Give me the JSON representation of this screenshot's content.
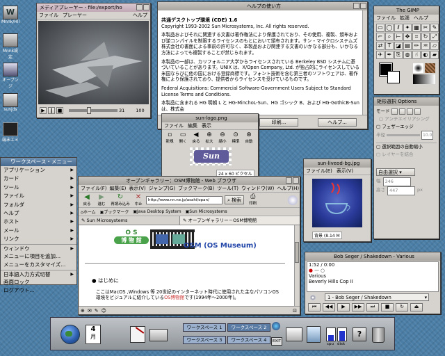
{
  "desktop_icons": [
    {
      "label": "Mnnk/Hll"
    },
    {
      "label": "Mnnk設定"
    },
    {
      "label": "オープンジ"
    },
    {
      "label": "sunjds"
    },
    {
      "label": "端末エミ"
    }
  ],
  "media_player": {
    "title": "メディアプレーヤー - file:/export/ho",
    "menu": [
      "ファイル",
      "プレーヤー",
      "ヘルプ"
    ],
    "position": "31",
    "volume": "100"
  },
  "help_window": {
    "title": "ヘルプの使い方",
    "heading": "共通デスクトップ環境 (CDE) 1.6",
    "copyright": "Copyright 1993-2002 Sun Microsystems, Inc. All rights reserved.",
    "paragraphs": [
      "本製品およびそれに関連する文書は著作権法により保護されており、その使用、複製、頒布および逆コンパイルを制限するライセンスのもとにおいて頒布されます。サン・マイクロシステムズ株式会社の書面による事前の許可なく、本製品および関連する文書のいかなる部分も、いかなる方法によっても複製することが禁じられます。",
      "本製品の一部は、カリフォルニア大学からライセンスされている Berkeley BSD システムに基づいていることがあります。UNIX は、X/Open Company, Ltd. が独占的にライセンスしている米国ならびに他の国における登録商標です。フォント技術を含む第三者のソフトウェアは、著作権により保護されており、提供者からライセンスを受けているものです。",
      "Federal Acquisitions: Commercial Software-Government Users Subject to Standard License Terms and Conditions.",
      "本製品に含まれる HG 明朝 L と HG-MinchoL-Sun、HG ゴシック B、および HG-GothicB-Sun は、株式会"
    ],
    "print": "印刷...",
    "help": "ヘルプ..."
  },
  "logo_viewer": {
    "title": "sun-logo.png",
    "menu": [
      "ファイル",
      "編集",
      "表示"
    ],
    "tools": [
      "新規",
      "開く",
      "戻る",
      "拡大",
      "縮小",
      "標準",
      "自動"
    ],
    "logo_text": "Sun",
    "status": "24 x 60 ピクセル"
  },
  "gimp_toolbox": {
    "title": "The GIMP",
    "menu": [
      "ファイル",
      "拡張",
      "ヘルプ"
    ]
  },
  "gimp_options": {
    "title": "矩形選択 Options",
    "mode_label": "モード",
    "antialias": "アンチエイリアシング",
    "feather": "フェザーエッジ",
    "radius_label": "半径",
    "radius_value": "10.0",
    "auto_shrink": "選択範囲の自動縮小",
    "merge": "レイヤーを結合",
    "fixed": "自由選択",
    "w_label": "幅",
    "w_value": "346",
    "h_label": "高さ",
    "h_value": "447",
    "unit": "px"
  },
  "java_viewer": {
    "title": "sun-liveod-bg.jpg",
    "menu": [
      "ファイル(E)",
      "表示(V)"
    ],
    "status": "背景 (8.14 M"
  },
  "browser": {
    "title": "オープンギャラリー：OSM博物館 - Web ブラウザ",
    "menu": [
      "ファイル(F)",
      "編集(E)",
      "表示(V)",
      "ジャンプ(G)",
      "ブックマーク(B)",
      "ツール(T)",
      "ウィンドウ(W)",
      "ヘルプ(H)"
    ],
    "nav": [
      "戻る",
      "進む",
      "再読み込み",
      "中止"
    ],
    "url": "http://www.nn.ne.jp/asahi/opan/",
    "search": "検索",
    "print": "印刷",
    "bookmarks": [
      "ホーム",
      "ブックマーク",
      "Java Desktop System",
      "Sun Microsystems"
    ],
    "tabs": [
      "Sun Microsystems",
      "オープンギャラリー－OSM博物館"
    ],
    "logo_top": "O S",
    "logo_bottom": "博 物 館",
    "museum_title": "OSM (OS Museum)",
    "bullet": "はじめに",
    "body_1": "ここはMacOS ,Windows 等 20世紀のインターネット時代に使用された主なパソコンOS",
    "body_2a": "環境をビジュアルに紹介している",
    "body_link": "OS博物館",
    "body_2b": "です(1994年～2000年)。"
  },
  "music_player": {
    "title": "Bob Seger / Shakedown - Various",
    "time": "1:52 / 0:00",
    "artist": "Various",
    "album": "Beverly Hills Cop II",
    "track": "1 - Bob Seger / Shakedown"
  },
  "workspace_menu": {
    "title": "ワークスペース・メニュー",
    "items": [
      {
        "label": "アプリケーション",
        "sub": true
      },
      {
        "label": "カード",
        "sub": true
      },
      {
        "label": "ツール",
        "sub": true
      },
      {
        "label": "ファイル",
        "sub": true
      },
      {
        "label": "フォルダ",
        "sub": true
      },
      {
        "label": "ヘルプ",
        "sub": true
      },
      {
        "label": "ホスト",
        "sub": true
      },
      {
        "label": "メール",
        "sub": true
      },
      {
        "label": "リンク",
        "sub": true
      },
      {
        "label": "ウィンドウ",
        "sub": true
      },
      {
        "label": "メニューに項目を追加...",
        "sub": false
      },
      {
        "label": "メニューをカスタマイズ...",
        "sub": false
      },
      {
        "label": "日本語入力方式切替",
        "sub": true
      },
      {
        "label": "画面ロック",
        "sub": false
      },
      {
        "label": "ログアウト...",
        "sub": false
      }
    ]
  },
  "front_panel": {
    "date_num": "4",
    "date_mon": "月",
    "workspaces": [
      "ワークスペース 1",
      "ワークスペース 2",
      "ワークスペース 3",
      "ワークスペース 4"
    ],
    "exit": "EXIT",
    "cpu": "cpu",
    "disk": "disk"
  }
}
